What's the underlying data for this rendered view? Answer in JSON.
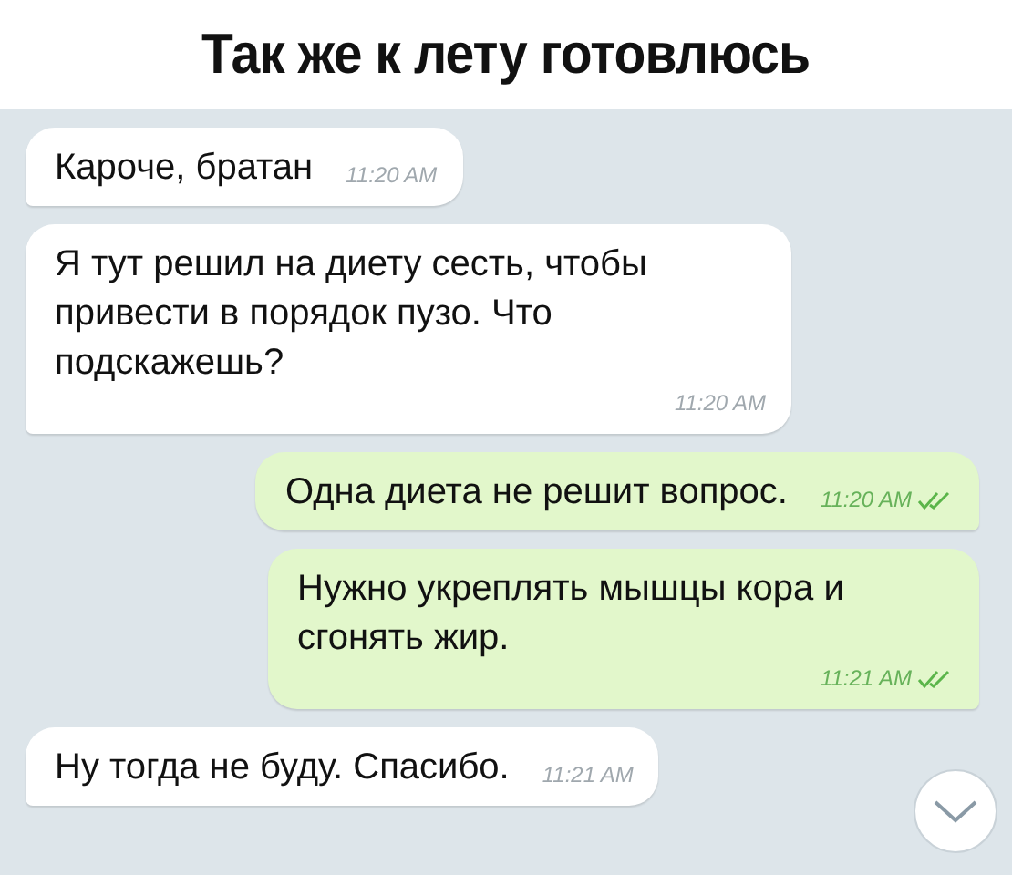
{
  "caption": "Так же к лету готовлюсь",
  "messages": [
    {
      "kind": "incoming",
      "text": "Кароче, братан",
      "time": "11:20 AM"
    },
    {
      "kind": "incoming",
      "text": "Я тут решил на диету сесть, чтобы привести в порядок пузо. Что подскажешь?",
      "time": "11:20 AM"
    },
    {
      "kind": "outgoing",
      "text": "Одна диета не решит вопрос.",
      "time": "11:20 AM",
      "read": true
    },
    {
      "kind": "outgoing",
      "text": "Нужно укреплять мышцы кора и сгонять жир.",
      "time": "11:21 AM",
      "read": true
    },
    {
      "kind": "incoming",
      "text": "Ну тогда не буду. Спасибо.",
      "time": "11:21 AM"
    }
  ]
}
